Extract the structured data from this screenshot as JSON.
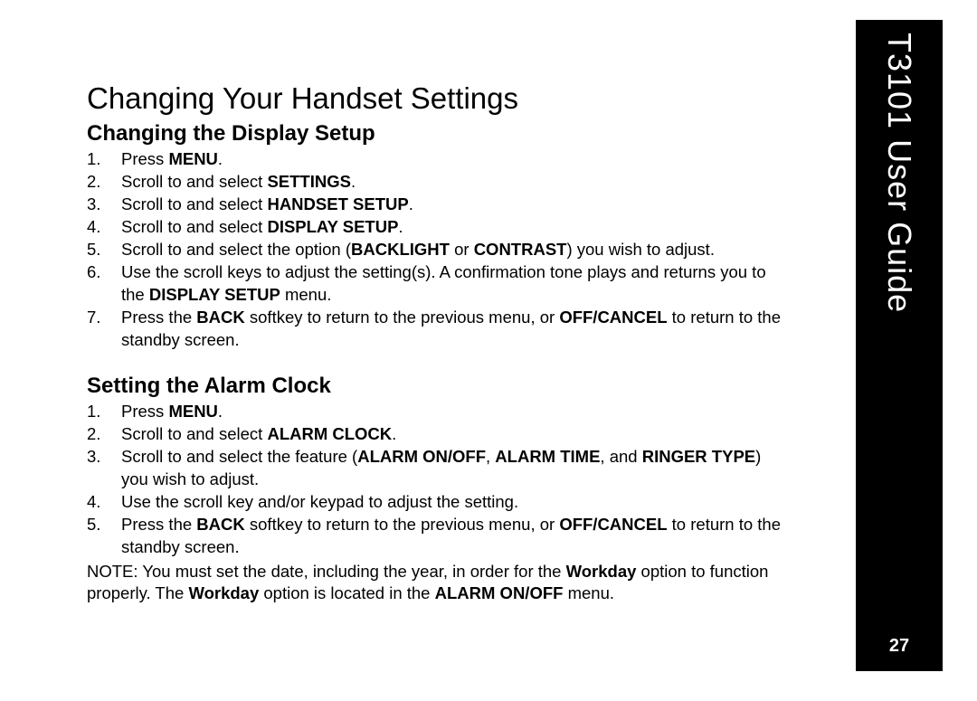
{
  "sidebar": {
    "title": "T3101 User Guide",
    "page_number": "27"
  },
  "page": {
    "title": "Changing Your Handset Settings"
  },
  "section1": {
    "heading": "Changing the Display Setup",
    "steps": {
      "s1_a": "Press ",
      "s1_b": "MENU",
      "s1_c": ".",
      "s2_a": "Scroll to and select ",
      "s2_b": "SETTINGS",
      "s2_c": ".",
      "s3_a": "Scroll to and select ",
      "s3_b": "HANDSET SETUP",
      "s3_c": ".",
      "s4_a": "Scroll to and select ",
      "s4_b": "DISPLAY SETUP",
      "s4_c": ".",
      "s5_a": "Scroll to and select the option (",
      "s5_b": "BACKLIGHT",
      "s5_c": " or ",
      "s5_d": "CONTRAST",
      "s5_e": ") you wish to adjust.",
      "s6_a": "Use the scroll keys to adjust the setting(s). A confirmation tone plays and returns you to the ",
      "s6_b": "DISPLAY SETUP",
      "s6_c": " menu.",
      "s7_a": "Press the ",
      "s7_b": "BACK",
      "s7_c": " softkey to return to the previous menu, or ",
      "s7_d": "OFF/CANCEL",
      "s7_e": " to return to the standby screen."
    }
  },
  "section2": {
    "heading": "Setting the Alarm Clock",
    "steps": {
      "s1_a": "Press ",
      "s1_b": "MENU",
      "s1_c": ".",
      "s2_a": "Scroll to and select ",
      "s2_b": "ALARM CLOCK",
      "s2_c": ".",
      "s3_a": "Scroll to and select the feature (",
      "s3_b": "ALARM ON/OFF",
      "s3_c": ", ",
      "s3_d": "ALARM TIME",
      "s3_e": ", and ",
      "s3_f": "RINGER TYPE",
      "s3_g": ") you wish to adjust.",
      "s4_a": "Use the scroll key and/or keypad to adjust the setting.",
      "s5_a": "Press the ",
      "s5_b": "BACK",
      "s5_c": " softkey to return to the previous menu, or ",
      "s5_d": "OFF/CANCEL",
      "s5_e": " to return to the standby screen."
    },
    "note": {
      "a": "NOTE:  You must set the date, including the year, in order for the ",
      "b": "Workday",
      "c": " option to function properly. The ",
      "d": "Workday",
      "e": " option is located in the ",
      "f": "ALARM ON/OFF",
      "g": " menu."
    }
  }
}
